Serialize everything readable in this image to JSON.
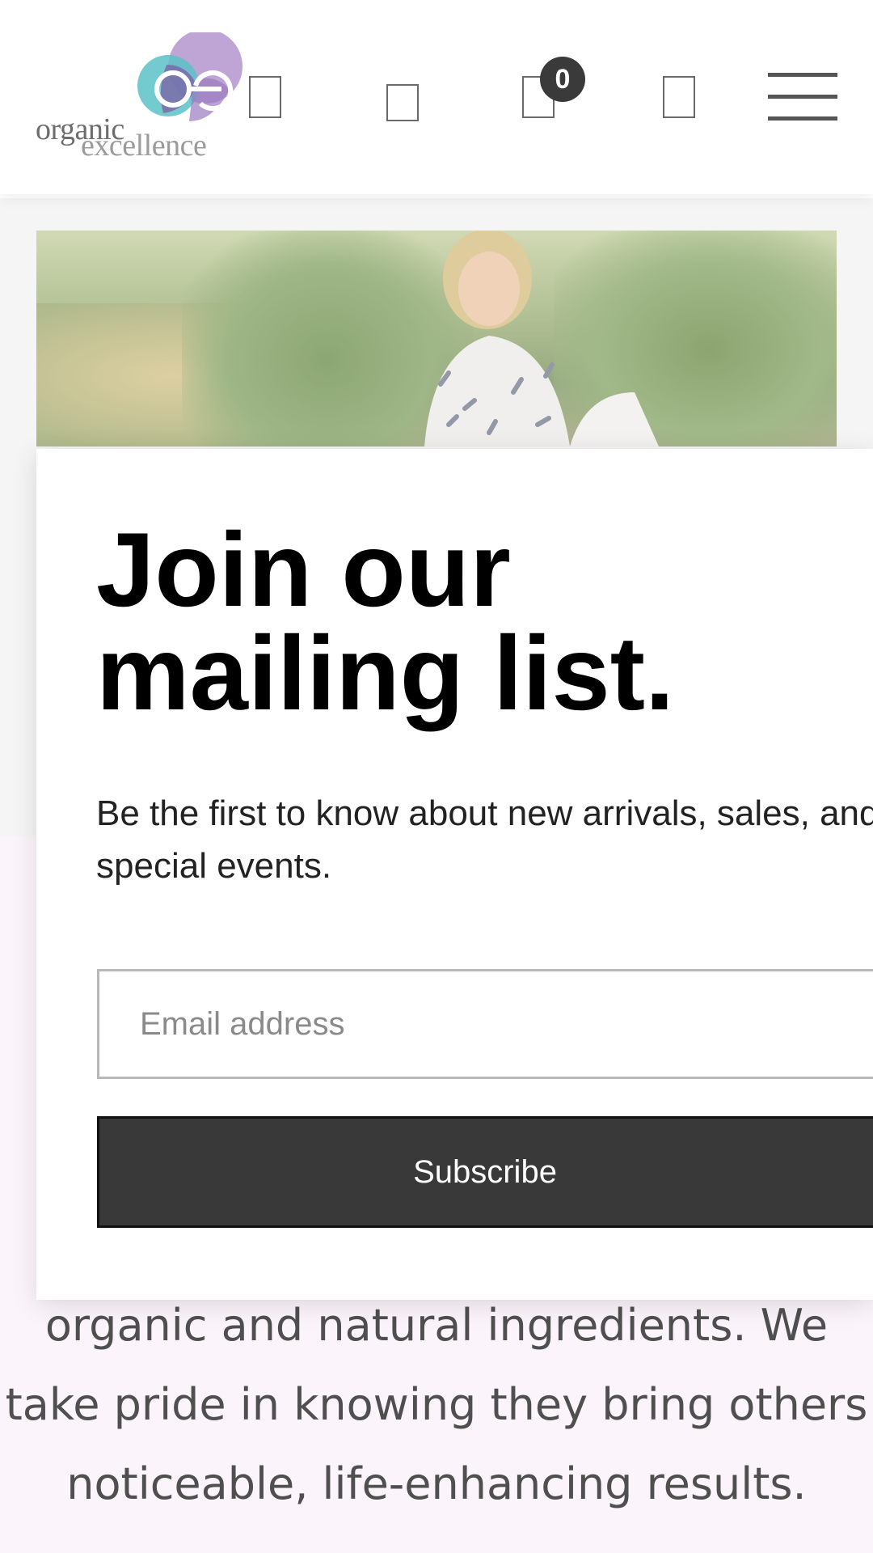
{
  "header": {
    "logo": {
      "line1": "organic",
      "line2": "excellence",
      "mark": "oe",
      "colors": [
        "#a67bbf",
        "#5bc2c7",
        "#b89ad1"
      ]
    },
    "icons": [
      "search-icon",
      "account-icon",
      "cart-icon",
      "wishlist-icon"
    ],
    "cart_count": "0",
    "menu_icon": "hamburger-menu-icon"
  },
  "popup": {
    "title": "Join our mailing list.",
    "subtitle": "Be the first to know about new arrivals, sales, and special events.",
    "email_placeholder": "Email address",
    "email_value": "",
    "subscribe_label": "Subscribe",
    "button_color": "#393939"
  },
  "background": {
    "text": "organic and natural ingredients. We take pride in knowing they bring others noticeable, life-enhancing results."
  }
}
